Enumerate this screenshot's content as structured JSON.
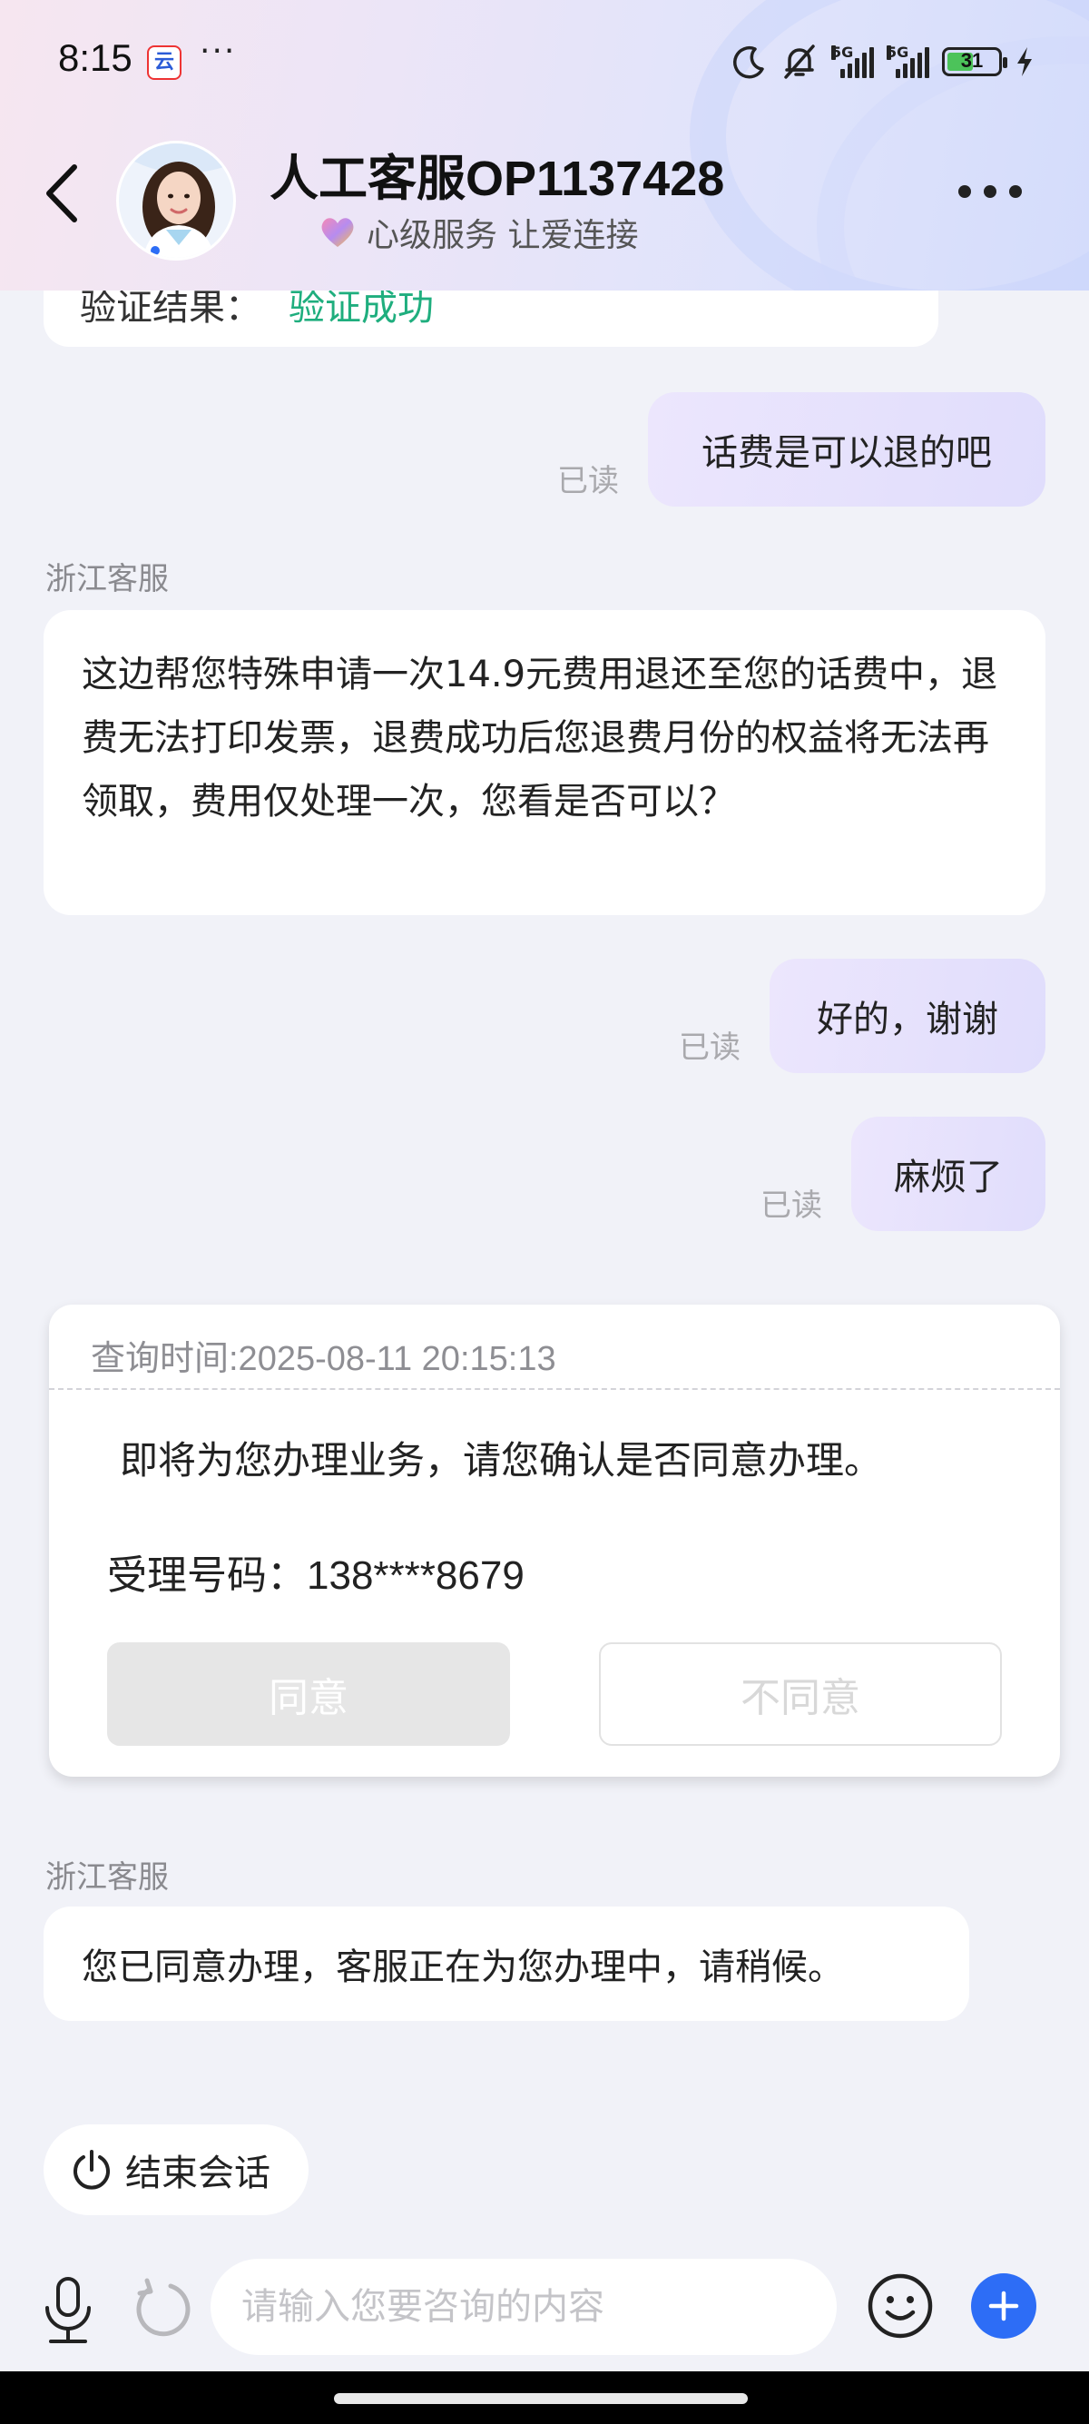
{
  "status_bar": {
    "time": "8:15",
    "app_badge": "云",
    "more_dots": "···",
    "network1": "5G",
    "network2": "5G",
    "battery": "31"
  },
  "header": {
    "agent_name": "人工客服OP1137428",
    "slogan": "心级服务 让爱连接"
  },
  "chat": {
    "verify": {
      "label": "验证结果：",
      "value": "验证成功"
    },
    "msg1": {
      "text": "话费是可以退的吧",
      "read": "已读"
    },
    "sender1": "浙江客服",
    "msg2": {
      "text": "这边帮您特殊申请一次14.9元费用退还至您的话费中，退费无法打印发票，退费成功后您退费月份的权益将无法再领取，费用仅处理一次，您看是否可以？"
    },
    "msg3": {
      "text": "好的，谢谢",
      "read": "已读"
    },
    "msg4": {
      "text": "麻烦了",
      "read": "已读"
    },
    "confirm_card": {
      "query_time": "查询时间:2025-08-11 20:15:13",
      "message": "即将为您办理业务，请您确认是否同意办理。",
      "number": "受理号码：138****8679",
      "agree": "同意",
      "disagree": "不同意"
    },
    "sender2": "浙江客服",
    "msg5": {
      "text": "您已同意办理，客服正在为您办理中，请稍候。"
    },
    "end_chat": "结束会话"
  },
  "input": {
    "placeholder": "请输入您要咨询的内容"
  },
  "colors": {
    "accent": "#2d6df6",
    "success": "#1fae7e",
    "outgoing_bubble": "#e4e0fc"
  }
}
